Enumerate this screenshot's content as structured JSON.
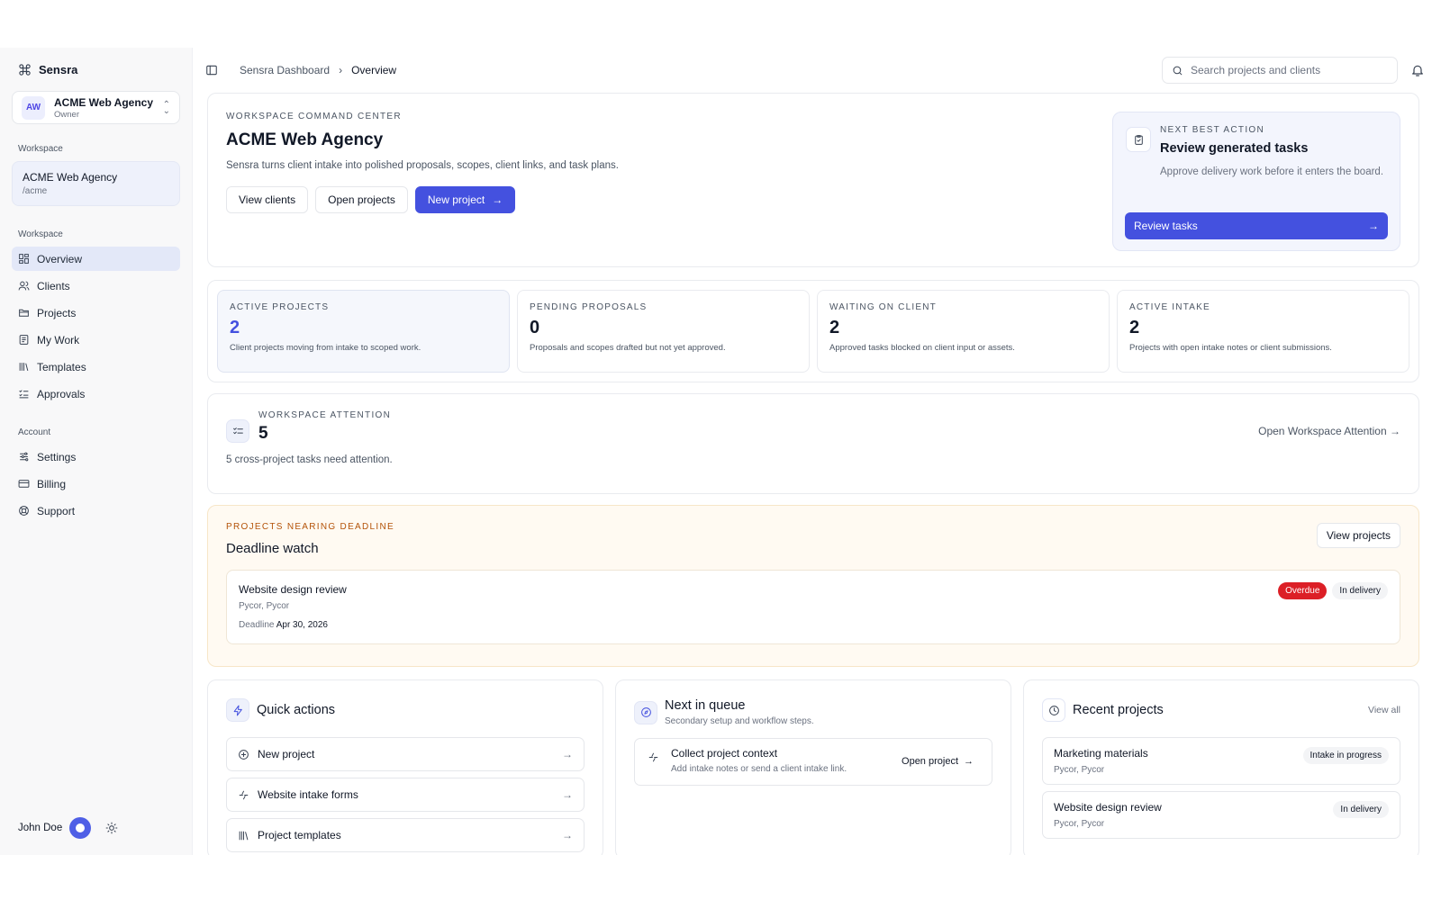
{
  "brand": {
    "name": "Sensra"
  },
  "workspace_switcher": {
    "initials": "AW",
    "name": "ACME Web Agency",
    "role": "Owner"
  },
  "sidebar": {
    "workspace_label": "Workspace",
    "workspace_card": {
      "name": "ACME Web Agency",
      "slug": "/acme"
    },
    "nav_label": "Workspace",
    "nav": [
      {
        "label": "Overview",
        "icon": "grid-icon",
        "active": true
      },
      {
        "label": "Clients",
        "icon": "users-icon"
      },
      {
        "label": "Projects",
        "icon": "folder-icon"
      },
      {
        "label": "My Work",
        "icon": "checklist-icon"
      },
      {
        "label": "Templates",
        "icon": "library-icon"
      },
      {
        "label": "Approvals",
        "icon": "list-check-icon"
      }
    ],
    "account_label": "Account",
    "account": [
      {
        "label": "Settings",
        "icon": "sliders-icon"
      },
      {
        "label": "Billing",
        "icon": "card-icon"
      },
      {
        "label": "Support",
        "icon": "lifebuoy-icon"
      }
    ],
    "user": {
      "name": "John Doe"
    }
  },
  "topbar": {
    "breadcrumb": [
      "Sensra Dashboard",
      "Overview"
    ],
    "search_placeholder": "Search projects and clients"
  },
  "hero": {
    "eyebrow": "WORKSPACE COMMAND CENTER",
    "title": "ACME Web Agency",
    "description": "Sensra turns client intake into polished proposals, scopes, client links, and task plans.",
    "buttons": {
      "view_clients": "View clients",
      "open_projects": "Open projects",
      "new_project": "New project"
    },
    "next_best_action": {
      "eyebrow": "NEXT BEST ACTION",
      "title": "Review generated tasks",
      "description": "Approve delivery work before it enters the board.",
      "button": "Review tasks"
    }
  },
  "stats": [
    {
      "label": "ACTIVE PROJECTS",
      "value": "2",
      "note": "Client projects moving from intake to scoped work."
    },
    {
      "label": "PENDING PROPOSALS",
      "value": "0",
      "note": "Proposals and scopes drafted but not yet approved."
    },
    {
      "label": "WAITING ON CLIENT",
      "value": "2",
      "note": "Approved tasks blocked on client input or assets."
    },
    {
      "label": "ACTIVE INTAKE",
      "value": "2",
      "note": "Projects with open intake notes or client submissions."
    }
  ],
  "attention": {
    "eyebrow": "WORKSPACE ATTENTION",
    "value": "5",
    "note": "5 cross-project tasks need attention.",
    "link": "Open Workspace Attention"
  },
  "deadline": {
    "eyebrow": "PROJECTS NEARING DEADLINE",
    "title": "Deadline watch",
    "button": "View projects",
    "item": {
      "name": "Website design review",
      "clients": "Pycor, Pycor",
      "deadline_label": "Deadline",
      "deadline": "Apr 30, 2026",
      "badge_overdue": "Overdue",
      "badge_status": "In delivery"
    }
  },
  "quick_actions": {
    "title": "Quick actions",
    "items": [
      {
        "label": "New project",
        "icon": "plus-circle-icon"
      },
      {
        "label": "Website intake forms",
        "icon": "spark-icon"
      },
      {
        "label": "Project templates",
        "icon": "library-icon"
      }
    ]
  },
  "queue": {
    "title": "Next in queue",
    "subtitle": "Secondary setup and workflow steps.",
    "item": {
      "title": "Collect project context",
      "subtitle": "Add intake notes or send a client intake link.",
      "action": "Open project"
    }
  },
  "recent_projects": {
    "title": "Recent projects",
    "view_all": "View all",
    "items": [
      {
        "name": "Marketing materials",
        "clients": "Pycor, Pycor",
        "status": "Intake in progress"
      },
      {
        "name": "Website design review",
        "clients": "Pycor, Pycor",
        "status": "In delivery"
      }
    ]
  },
  "colors": {
    "accent": "#4451df",
    "overdue": "#dc1f26",
    "deadline_accent": "#b45309"
  }
}
